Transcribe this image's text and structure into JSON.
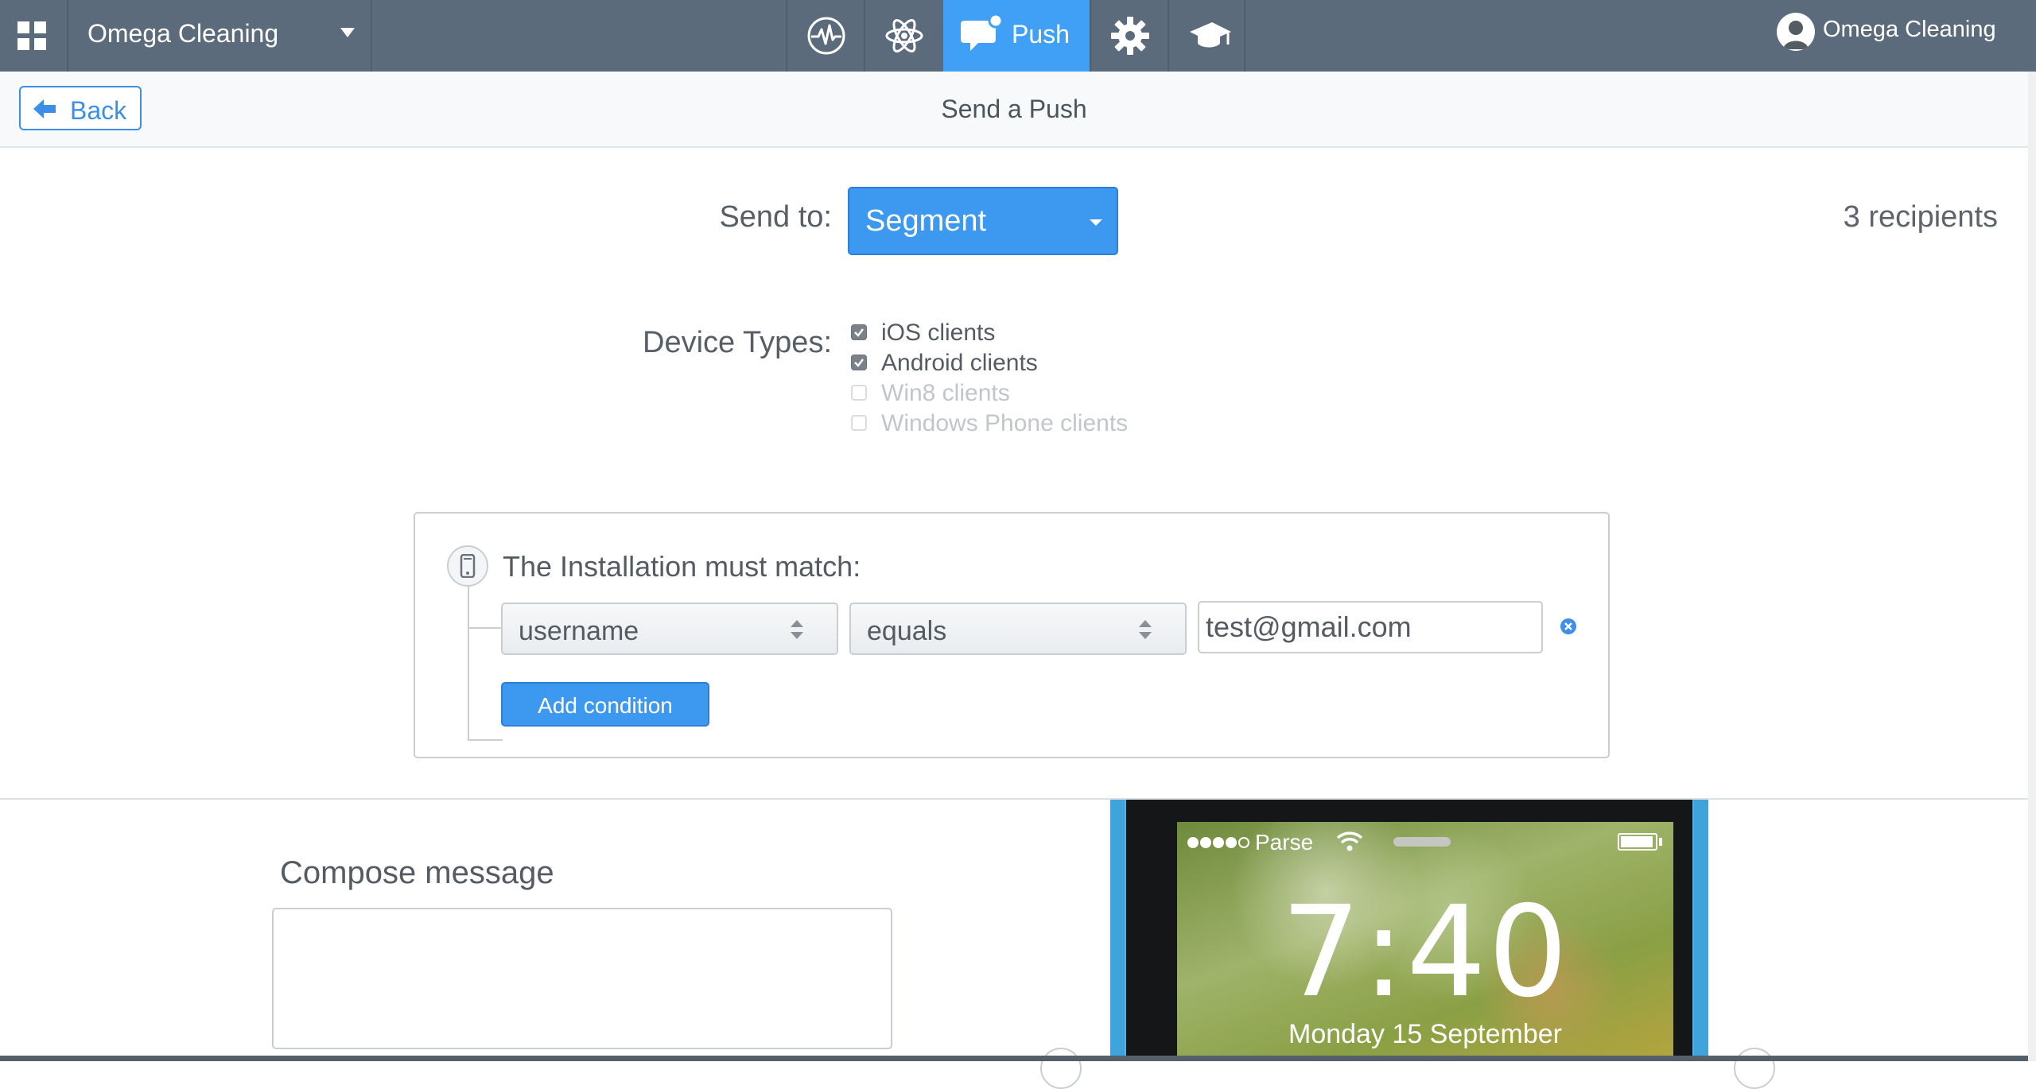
{
  "app": {
    "name": "Omega Cleaning",
    "user_name": "Omega Cleaning"
  },
  "nav": {
    "items": [
      {
        "icon": "analytics-icon"
      },
      {
        "icon": "core-icon"
      },
      {
        "icon": "push-icon",
        "label": "Push",
        "active": true
      },
      {
        "icon": "settings-icon"
      },
      {
        "icon": "docs-icon"
      }
    ],
    "active_color": "#3fa0f5",
    "bar_color": "#5b6b7c"
  },
  "header": {
    "back_label": "Back",
    "title": "Send a Push"
  },
  "form": {
    "send_to_label": "Send to:",
    "send_to_value": "Segment",
    "recipients": "3 recipients",
    "device_types_label": "Device Types:",
    "device_types": [
      {
        "label": "iOS clients",
        "checked": true,
        "enabled": true
      },
      {
        "label": "Android clients",
        "checked": true,
        "enabled": true
      },
      {
        "label": "Win8 clients",
        "checked": false,
        "enabled": false
      },
      {
        "label": "Windows Phone clients",
        "checked": false,
        "enabled": false
      }
    ]
  },
  "condition": {
    "title": "The Installation must match:",
    "field": "username",
    "operator": "equals",
    "value": "test@gmail.com",
    "add_label": "Add condition"
  },
  "compose": {
    "title": "Compose message",
    "message": ""
  },
  "preview": {
    "carrier": "Parse",
    "time": "7:40",
    "date": "Monday 15 September"
  }
}
